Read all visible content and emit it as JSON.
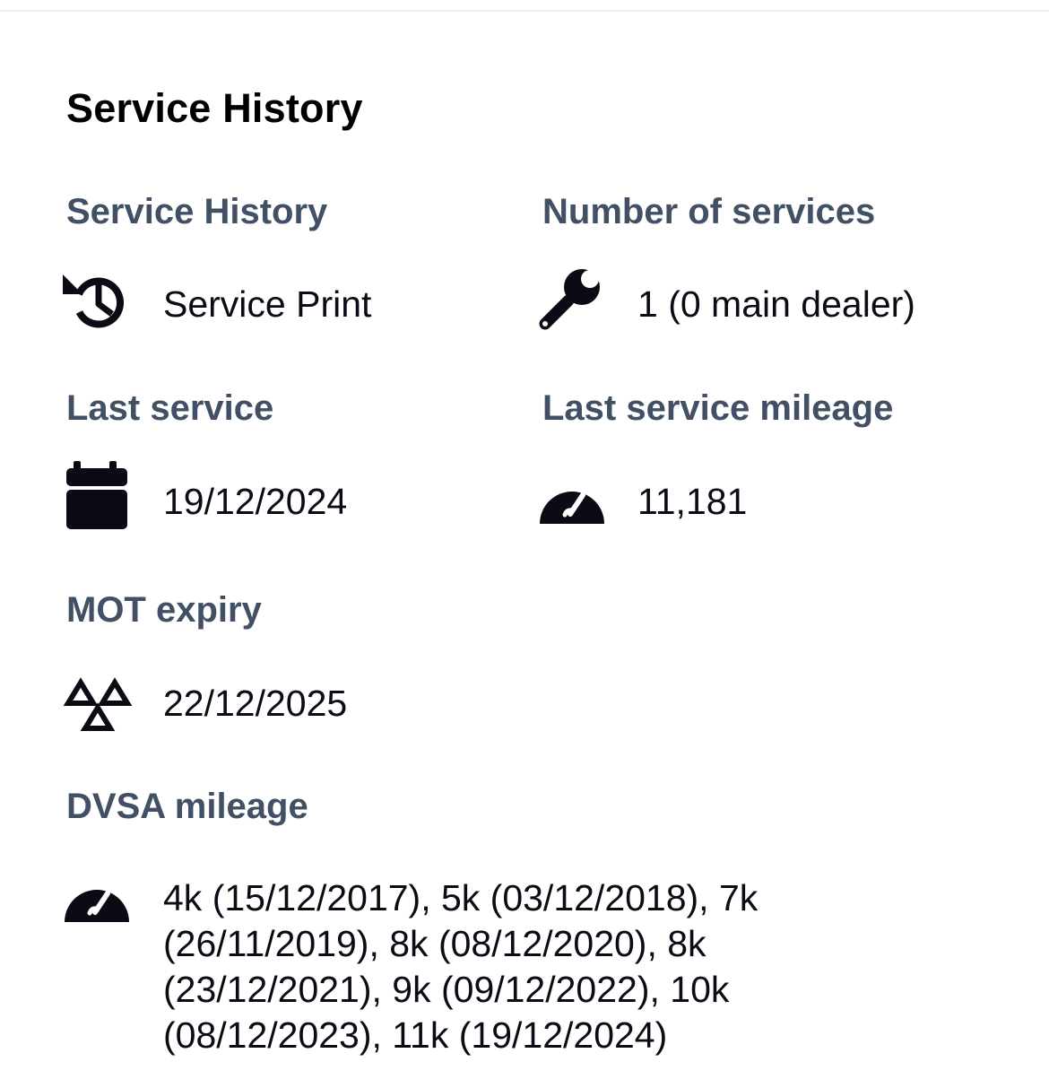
{
  "section": {
    "title": "Service History"
  },
  "fields": {
    "service_history": {
      "label": "Service History",
      "value": "Service Print",
      "icon": "history-icon"
    },
    "number_of_services": {
      "label": "Number of services",
      "value": "1 (0 main dealer)",
      "icon": "wrench-icon"
    },
    "last_service": {
      "label": "Last service",
      "value": "19/12/2024",
      "icon": "calendar-icon"
    },
    "last_service_mileage": {
      "label": "Last service mileage",
      "value": "11,181",
      "icon": "speedometer-icon"
    },
    "mot_expiry": {
      "label": "MOT expiry",
      "value": "22/12/2025",
      "icon": "mot-triangles-icon"
    },
    "dvsa_mileage": {
      "label": "DVSA mileage",
      "value": "4k (15/12/2017), 5k (03/12/2018), 7k (26/11/2019), 8k (08/12/2020), 8k (23/12/2021), 9k (09/12/2022), 10k (08/12/2023), 11k (19/12/2024)",
      "icon": "speedometer-icon"
    }
  },
  "colors": {
    "label": "#425066",
    "value": "#0b0b16",
    "title": "#000000",
    "icon": "#0b0b16"
  }
}
